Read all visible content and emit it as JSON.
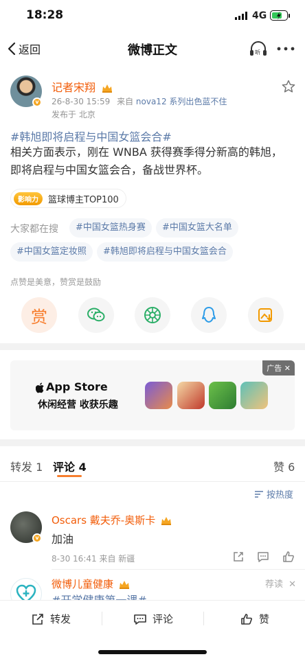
{
  "status_bar": {
    "time": "18:28",
    "network": "4G"
  },
  "nav": {
    "back_label": "返回",
    "title": "微博正文"
  },
  "post": {
    "username": "记者宋翔",
    "timestamp": "26-8-30 15:59",
    "source_prefix": "来自",
    "source": "nova12 系列出色蓝不住",
    "location": "发布于 北京",
    "topic": "#韩旭即将启程与中国女篮会合#",
    "body": "相关方面表示，刚在 WNBA 获得赛季得分新高的韩旭，即将启程与中国女篮会合，备战世界杯。",
    "influence_badge": "影响力",
    "influence_label": "篮球博主TOP100",
    "hot_search_label": "大家都在搜",
    "hot_searches": [
      "#中国女篮热身赛",
      "#中国女篮大名单",
      "#中国女篮定妆照",
      "#韩旭即将启程与中国女篮会合"
    ],
    "reward_tip": "点赞是美意，赞赏是鼓励",
    "reward_label": "赏"
  },
  "ad": {
    "tag": "广告",
    "brand": "App Store",
    "slogan": "休闲经营 收获乐趣"
  },
  "tabs": {
    "repost": "转发 1",
    "comment": "评论 4",
    "like": "赞 6"
  },
  "sort_label": "按热度",
  "comments": [
    {
      "name": "Oscars 戴夫乔-奥斯卡",
      "text": "加油",
      "meta": "8-30 16:41 来自 新疆"
    },
    {
      "name": "微博儿童健康",
      "text": "#开学健康第一课#",
      "tag": "荐读"
    }
  ],
  "bottom_bar": {
    "repost": "转发",
    "comment": "评论",
    "like": "赞"
  },
  "colors": {
    "accent": "#f77d2d",
    "username": "#f25d0a",
    "link": "#5b7aa8"
  }
}
